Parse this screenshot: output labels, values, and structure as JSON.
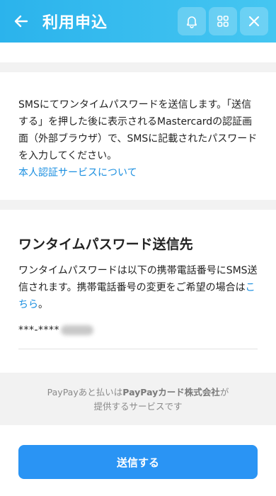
{
  "header": {
    "title": "利用申込",
    "back_icon": "arrow-left-icon",
    "actions": [
      "bell-icon",
      "apps-icon",
      "close-icon"
    ],
    "color": "#2bb3ec"
  },
  "otp_info": {
    "description": "SMSにてワンタイムパスワードを送信します。「送信する」を押した後に表示されるMastercardの認証画面（外部ブラウザ）で、SMSに記載されたパスワードを入力してください。",
    "link": "本人認証サービスについて"
  },
  "destination": {
    "title": "ワンタイムパスワード送信先",
    "description_prefix": "ワンタイムパスワードは以下の携帯電話番号にSMS送信されます。携帯電話番号の変更をご希望の場合は",
    "description_link": "こちら",
    "description_suffix": "。",
    "phone": "***-****"
  },
  "footer": {
    "brand": "PayPay",
    "text_a": "あと払いは",
    "brand_company": "PayPayカード株式会社",
    "text_b": "が",
    "text_c": "提供するサービスです"
  },
  "submit_button": {
    "label": "送信する",
    "color": "#2a94f4"
  }
}
